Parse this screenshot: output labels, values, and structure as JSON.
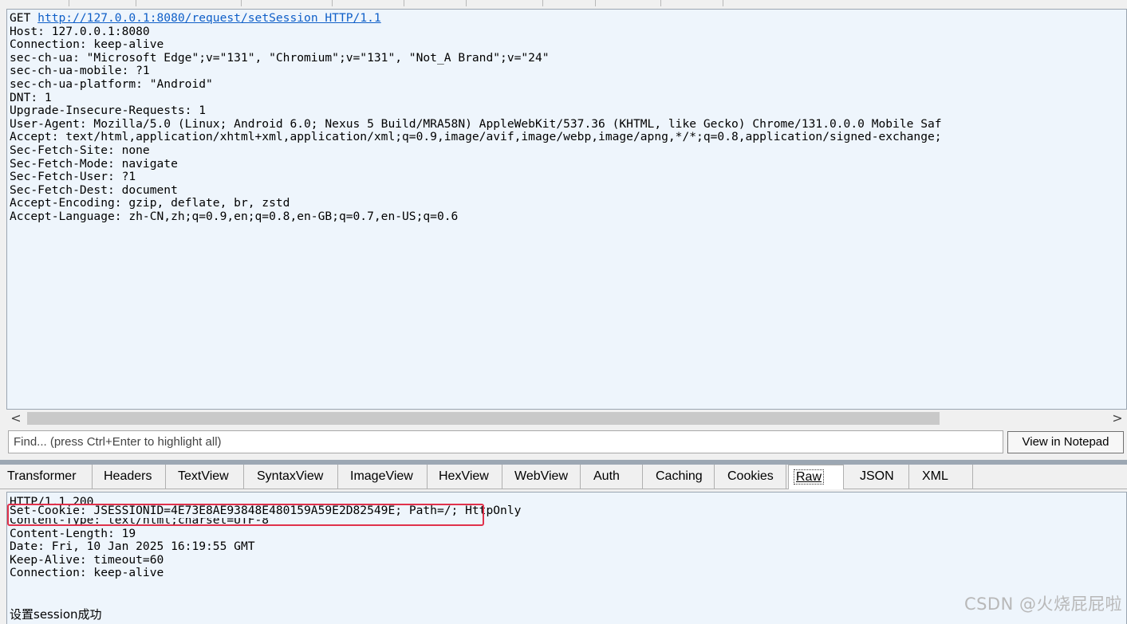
{
  "request": {
    "method": "GET",
    "url": "http://127.0.0.1:8080/request/setSession HTTP/1.1",
    "headers": [
      "Host: 127.0.0.1:8080",
      "Connection: keep-alive",
      "sec-ch-ua: \"Microsoft Edge\";v=\"131\", \"Chromium\";v=\"131\", \"Not_A Brand\";v=\"24\"",
      "sec-ch-ua-mobile: ?1",
      "sec-ch-ua-platform: \"Android\"",
      "DNT: 1",
      "Upgrade-Insecure-Requests: 1",
      "User-Agent: Mozilla/5.0 (Linux; Android 6.0; Nexus 5 Build/MRA58N) AppleWebKit/537.36 (KHTML, like Gecko) Chrome/131.0.0.0 Mobile Saf",
      "Accept: text/html,application/xhtml+xml,application/xml;q=0.9,image/avif,image/webp,image/apng,*/*;q=0.8,application/signed-exchange;",
      "Sec-Fetch-Site: none",
      "Sec-Fetch-Mode: navigate",
      "Sec-Fetch-User: ?1",
      "Sec-Fetch-Dest: document",
      "Accept-Encoding: gzip, deflate, br, zstd",
      "Accept-Language: zh-CN,zh;q=0.9,en;q=0.8,en-GB;q=0.7,en-US;q=0.6"
    ]
  },
  "scrollbar": {
    "left_arrow": "<",
    "right_arrow": ">"
  },
  "find": {
    "placeholder": "Find... (press Ctrl+Enter to highlight all)",
    "notepad_label": "View in Notepad"
  },
  "response_tabs": {
    "active": "Raw",
    "items": [
      "Transformer",
      "Headers",
      "TextView",
      "SyntaxView",
      "ImageView",
      "HexView",
      "WebView",
      "Auth",
      "Caching",
      "Cookies",
      "Raw",
      "JSON",
      "XML"
    ]
  },
  "response": {
    "status_line": "HTTP/1.1 200",
    "set_cookie": "Set-Cookie: JSESSIONID=4E73E8AE93848E480159A59E2D82549E;",
    "set_cookie_rest": " Path=/; HttpOnly",
    "headers": [
      "Content-Type: text/html;charset=UTF-8",
      "Content-Length: 19",
      "Date: Fri, 10 Jan 2025 16:19:55 GMT",
      "Keep-Alive: timeout=60",
      "Connection: keep-alive"
    ],
    "body": "设置session成功"
  },
  "watermark": "CSDN @火烧屁屁啦",
  "colors": {
    "pane_bg": "#eef5fc",
    "link": "#0f5fc8",
    "highlight": "#e0314b"
  }
}
